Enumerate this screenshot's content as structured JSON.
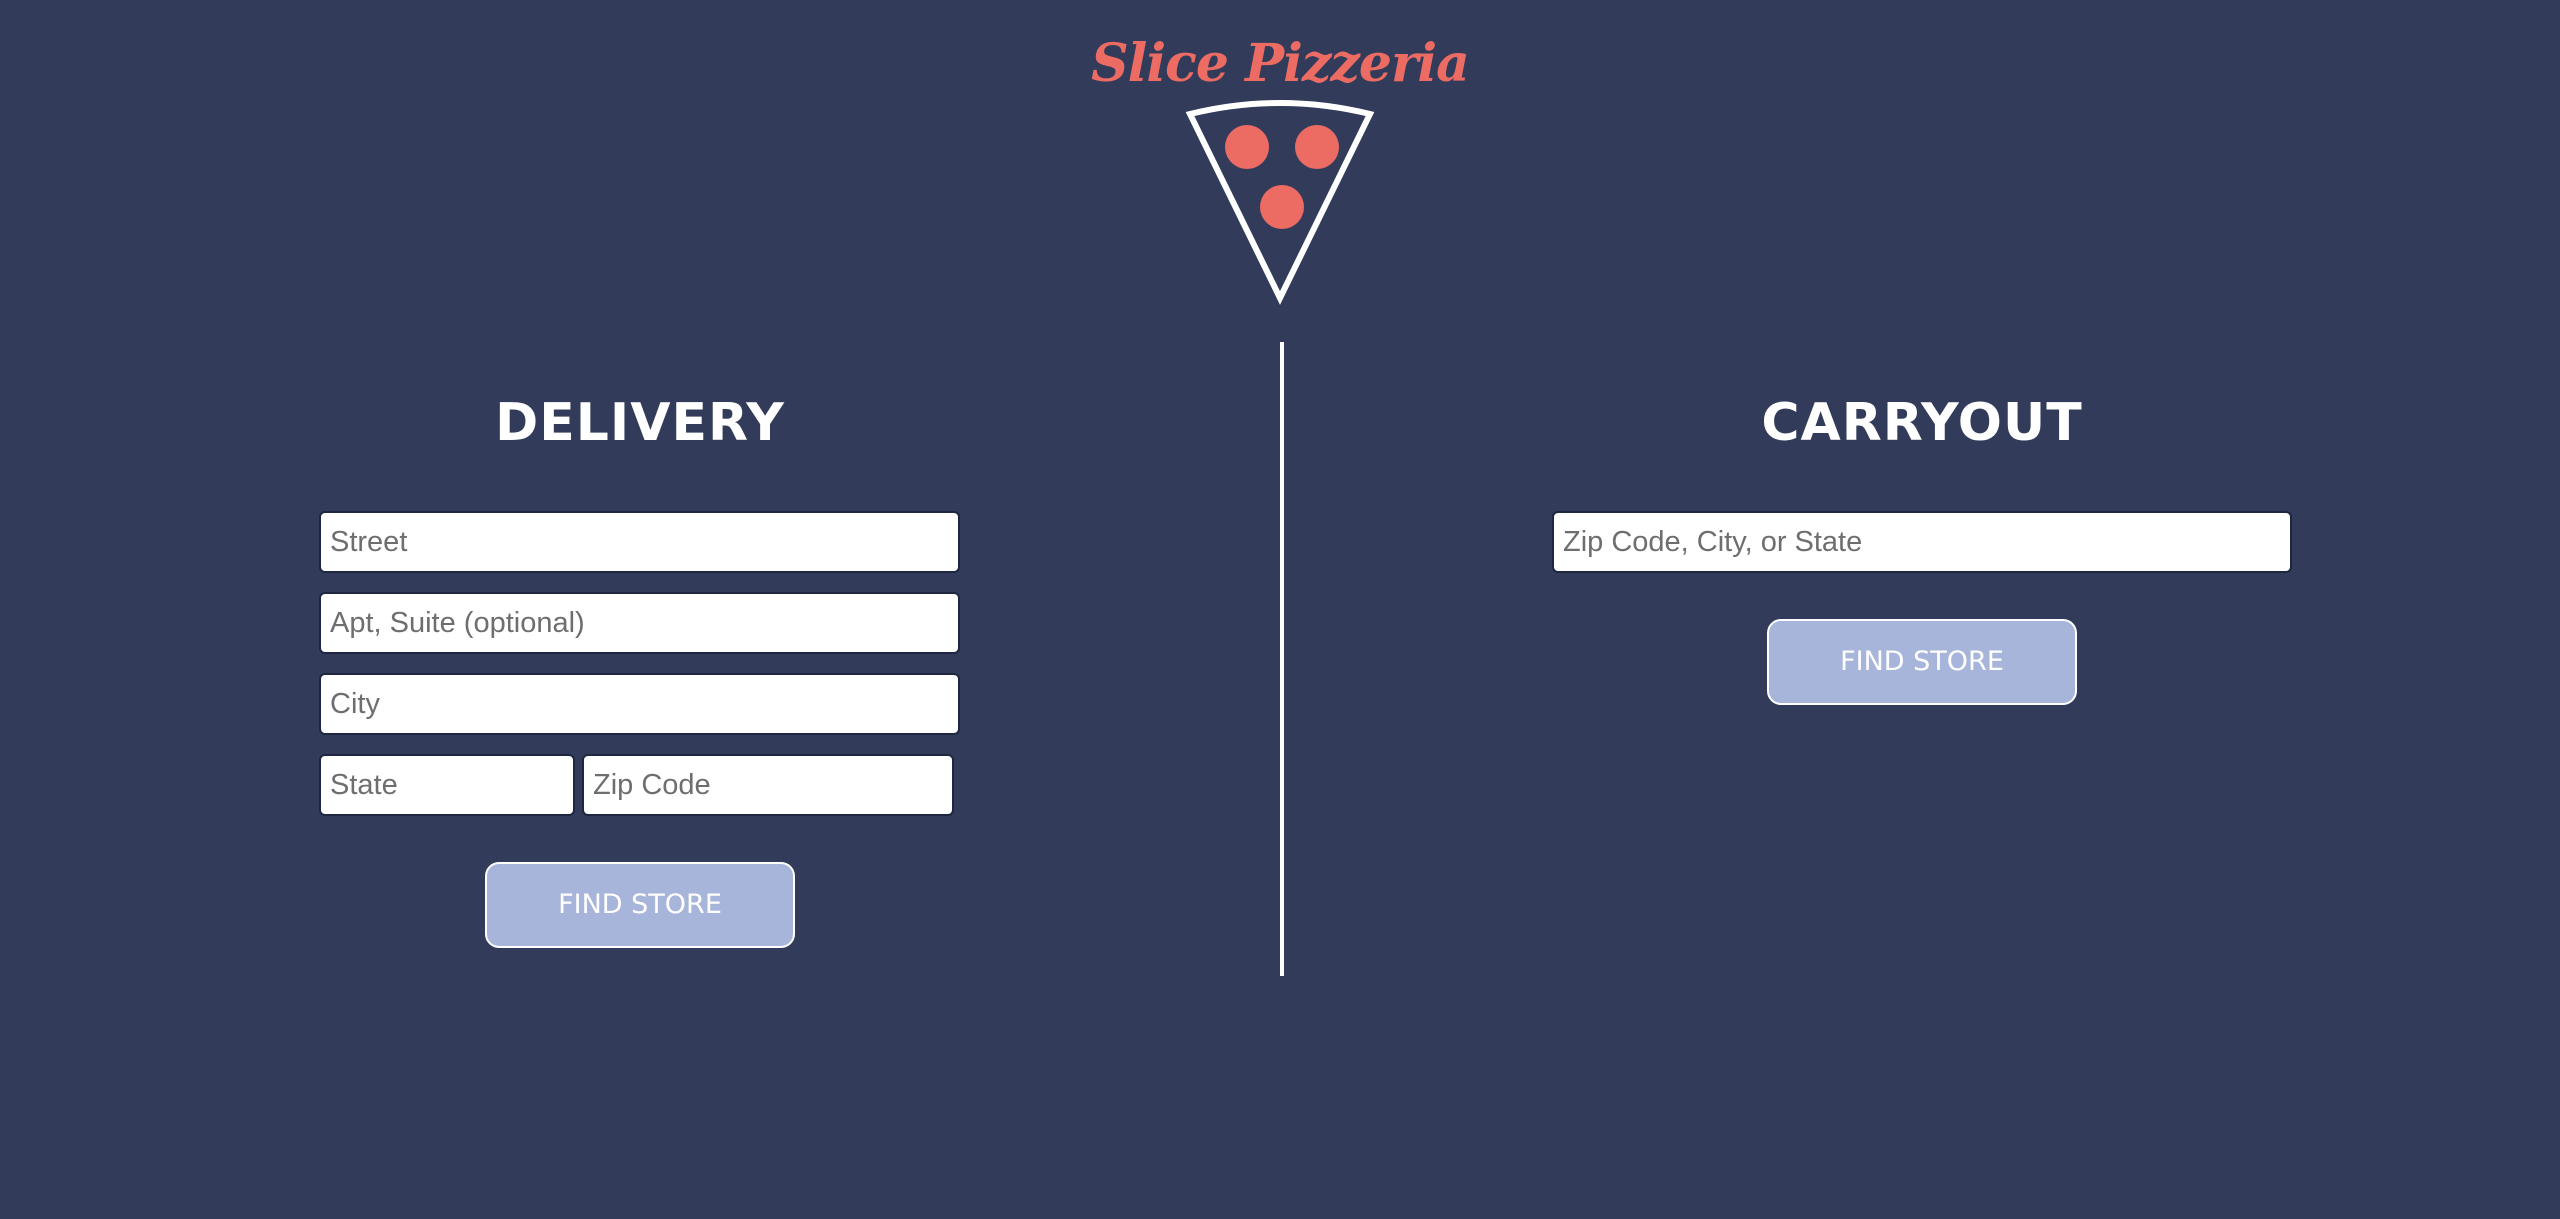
{
  "brand": {
    "name": "Slice Pizzeria",
    "logo_icon": "pizza-slice-icon",
    "accent_color": "#ec6b63",
    "background_color": "#323c5a"
  },
  "delivery": {
    "heading": "DELIVERY",
    "street_placeholder": "Street",
    "apt_placeholder": "Apt, Suite (optional)",
    "city_placeholder": "City",
    "state_placeholder": "State",
    "zip_placeholder": "Zip Code",
    "button_label": "FIND STORE"
  },
  "carryout": {
    "heading": "CARRYOUT",
    "location_placeholder": "Zip Code, City, or State",
    "button_label": "FIND STORE"
  },
  "button_color": "#a8b5db"
}
